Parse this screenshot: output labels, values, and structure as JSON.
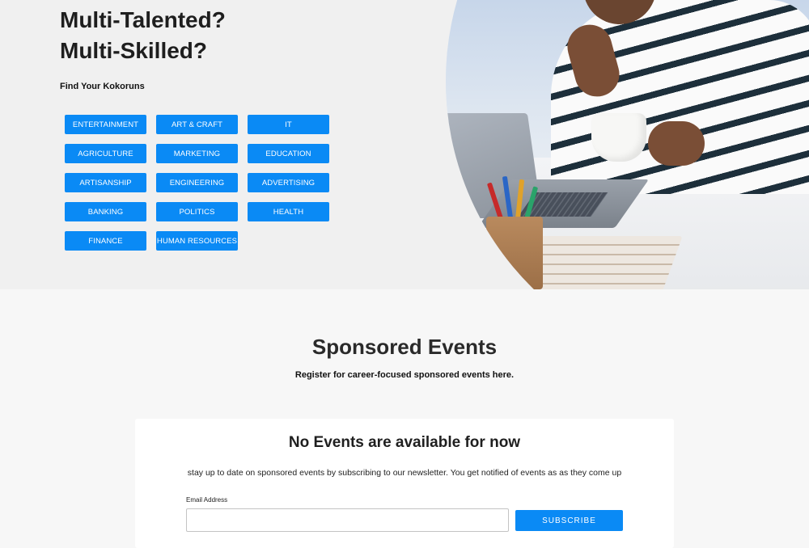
{
  "hero": {
    "title_line1": "Multi-Talented?",
    "title_line2": "Multi-Skilled?",
    "subtitle": "Find Your Kokoruns",
    "categories": [
      "ENTERTAINMENT",
      "ART & CRAFT",
      "IT",
      "AGRICULTURE",
      "MARKETING",
      "EDUCATION",
      "ARTISANSHIP",
      "ENGINEERING",
      "ADVERTISING",
      "BANKING",
      "POLITICS",
      "HEALTH",
      "FINANCE",
      "HUMAN RESOURCES"
    ]
  },
  "sponsored": {
    "title": "Sponsored Events",
    "subtitle": "Register for career-focused sponsored events here."
  },
  "events_card": {
    "title": "No Events are available for now",
    "description": "stay up to date on sponsored events by subscribing to our newsletter. You get notified of events as as they come up",
    "email_label": "Email Address",
    "email_value": "",
    "email_placeholder": "",
    "subscribe_label": "Subscribe"
  },
  "colors": {
    "accent": "#0a8af5",
    "hero_bg": "#f0f0f0",
    "page_bg": "#f7f7f7"
  }
}
